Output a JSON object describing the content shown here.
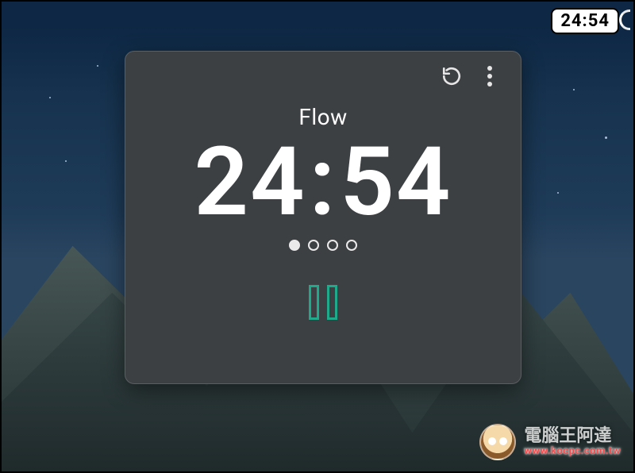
{
  "status_bar": {
    "clock": "24:54"
  },
  "timer_card": {
    "title": "Flow",
    "minutes": "24",
    "seconds": "54",
    "sessions_total": 4,
    "sessions_done": 1,
    "state": "running",
    "buttons": {
      "reset": "reset-icon",
      "more": "more-icon",
      "pause": "pause"
    },
    "colors": {
      "card_bg": "#3d4043",
      "accent": "#1faa8c",
      "text": "#ffffff"
    }
  },
  "watermark": {
    "title_cn": "電腦王阿達",
    "url": "www.kocpc.com.tw"
  }
}
